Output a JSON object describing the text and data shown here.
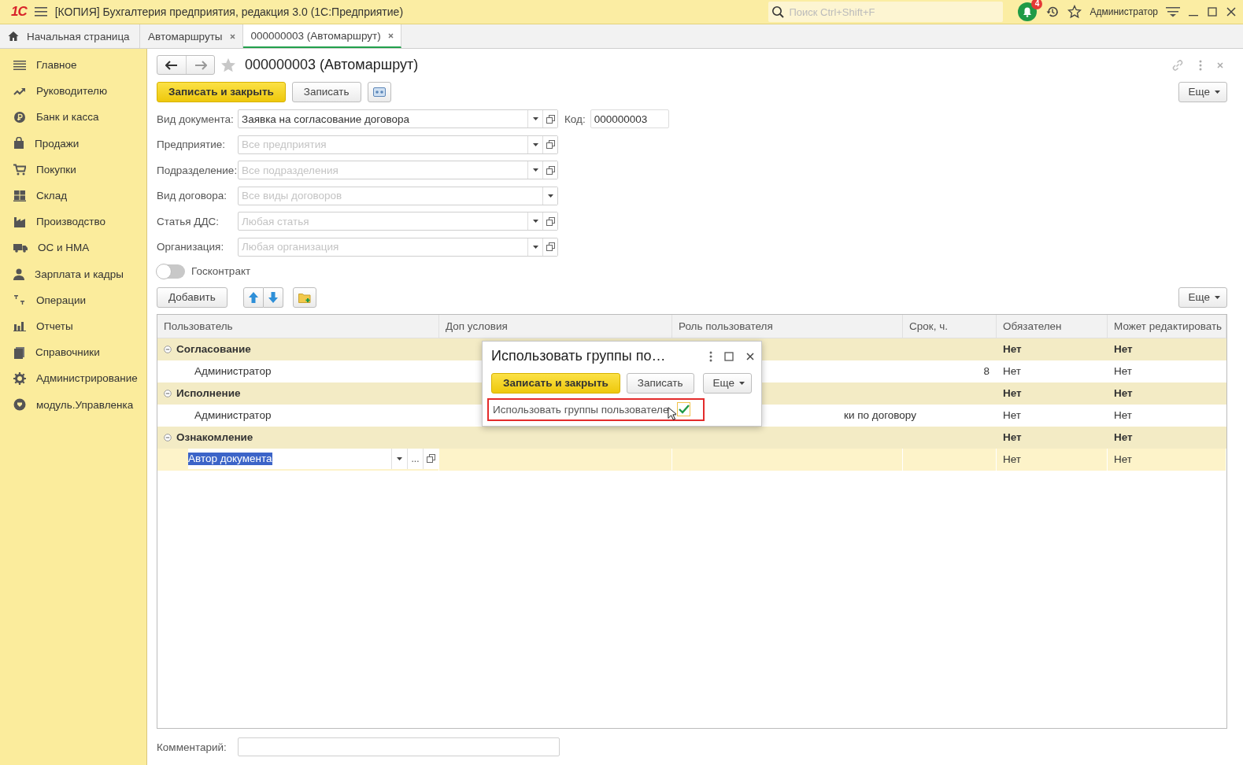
{
  "window": {
    "logo": "1С",
    "title": "[КОПИЯ] Бухгалтерия предприятия, редакция 3.0  (1С:Предприятие)",
    "search_placeholder": "Поиск Ctrl+Shift+F",
    "notifications": "4",
    "user": "Администратор"
  },
  "tabs": [
    {
      "label": "Начальная страница",
      "kind": "home",
      "selected": false
    },
    {
      "label": "Автомаршруты",
      "kind": "closable",
      "selected": false
    },
    {
      "label": "000000003 (Автомаршрут)",
      "kind": "closable",
      "selected": true
    }
  ],
  "sidebar": {
    "items": [
      {
        "label": "Главное"
      },
      {
        "label": "Руководителю"
      },
      {
        "label": "Банк и касса"
      },
      {
        "label": "Продажи"
      },
      {
        "label": "Покупки"
      },
      {
        "label": "Склад"
      },
      {
        "label": "Производство"
      },
      {
        "label": "ОС и НМА"
      },
      {
        "label": "Зарплата и кадры"
      },
      {
        "label": "Операции"
      },
      {
        "label": "Отчеты"
      },
      {
        "label": "Справочники"
      },
      {
        "label": "Администрирование"
      },
      {
        "label": "модуль.Управленка"
      }
    ]
  },
  "form": {
    "title": "000000003 (Автомаршрут)",
    "buttons": [
      {
        "label": "Записать и закрыть",
        "kind": "primary"
      },
      {
        "label": "Записать",
        "kind": "normal"
      }
    ],
    "more": "Еще",
    "fields": [
      {
        "label": "Вид документа:",
        "value": "Заявка на согласование договора",
        "open_button": true
      },
      {
        "label": "Предприятие:",
        "placeholder": "Все предприятия",
        "open_button": true
      },
      {
        "label": "Подразделение:",
        "placeholder": "Все подразделения",
        "open_button": true
      },
      {
        "label": "Вид договора:",
        "placeholder": "Все виды договоров",
        "open_button": false
      },
      {
        "label": "Статья ДДС:",
        "placeholder": "Любая статья",
        "open_button": true
      },
      {
        "label": "Организация:",
        "placeholder": "Любая организация",
        "open_button": true
      }
    ],
    "code": {
      "label": "Код:",
      "value": "000000003"
    },
    "toggle": {
      "label": "Госконтракт",
      "on": false
    },
    "table_toolbar": {
      "add": "Добавить",
      "more": "Еще"
    },
    "table": {
      "columns": [
        "Пользователь",
        "Доп условия",
        "Роль пользователя",
        "Срок, ч.",
        "Обязателен",
        "Может редактировать"
      ],
      "rows": [
        {
          "kind": "group",
          "expanded": true,
          "selected": false,
          "cells": [
            "Согласование",
            "",
            "",
            "",
            "Нет",
            "Нет"
          ]
        },
        {
          "kind": "item",
          "selected": false,
          "cells": [
            "Администратор",
            "",
            "",
            "8",
            "Нет",
            "Нет"
          ]
        },
        {
          "kind": "group",
          "expanded": true,
          "selected": false,
          "cells": [
            "Исполнение",
            "",
            "",
            "",
            "Нет",
            "Нет"
          ]
        },
        {
          "kind": "item",
          "selected": false,
          "partly_hidden_role": true,
          "cells": [
            "Администратор",
            "",
            "ки по договору",
            "",
            "Нет",
            "Нет"
          ]
        },
        {
          "kind": "group",
          "expanded": true,
          "selected": false,
          "cells": [
            "Ознакомление",
            "",
            "",
            "",
            "Нет",
            "Нет"
          ]
        },
        {
          "kind": "editing",
          "selected": true,
          "ellipsis": "...",
          "cells": [
            "Автор документа",
            "",
            "",
            "",
            "Нет",
            "Нет"
          ]
        }
      ]
    },
    "comment": {
      "label": "Комментарий:"
    }
  },
  "dialog": {
    "title": "Использовать группы по…",
    "buttons": [
      {
        "label": "Записать и закрыть",
        "kind": "primary"
      },
      {
        "label": "Записать",
        "kind": "normal"
      }
    ],
    "more": "Еще",
    "checkbox": {
      "label": "Использовать группы пользователе",
      "checked": true,
      "highlighted": true
    }
  }
}
